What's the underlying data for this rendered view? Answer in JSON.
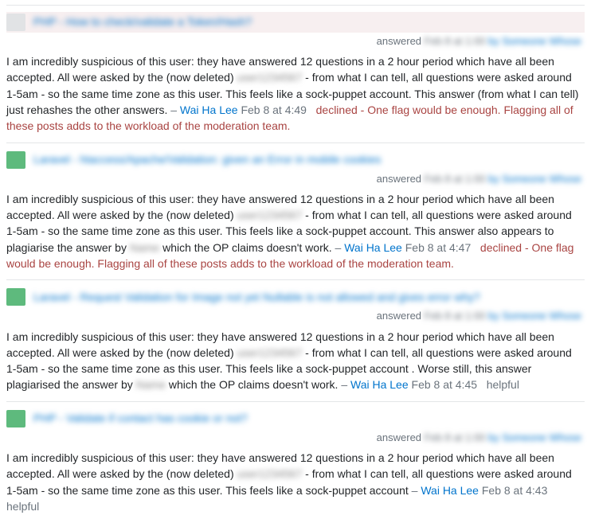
{
  "common": {
    "answered_label": "answered",
    "dash": "–",
    "author": "Wai Ha Lee",
    "redacted_user": "user1234567",
    "redacted_user2": "Name",
    "meta_date": "Feb 8 at 1:00",
    "meta_date2": "Feb 8 at 1:00",
    "meta_user": "by Someone Whose",
    "decline_msg": "declined - One flag would be enough. Flagging all of these posts adds to the workload of the moderation team.",
    "helpful_msg": "helpful"
  },
  "entries": [
    {
      "selected": true,
      "badge": "neutral",
      "title": "PHP - How to check/validate a Token/Hash?",
      "comment_pre": "I am incredibly suspicious of this user: they have answered 12 questions in a 2 hour period which have all been accepted. All were asked by the (now deleted) ",
      "comment_post": " - from what I can tell, all questions were asked around 1-5am - so the same time zone as this user. This feels like a sock-puppet account. This answer (from what I can tell) just rehashes the other answers.",
      "ts": "Feb 8 at 4:49",
      "result": "decline"
    },
    {
      "selected": false,
      "badge": "accepted",
      "title": "Laravel - htaccess/Apache/Validation: given an Error in mobile cookies",
      "comment_pre": "I am incredibly suspicious of this user: they have answered 12 questions in a 2 hour period which have all been accepted. All were asked by the (now deleted) ",
      "comment_mid": " - from what I can tell, all questions were asked around 1-5am - so the same time zone as this user. This feels like a sock-puppet account. This answer also appears to plagiarise the answer by ",
      "comment_post": " which the OP claims doesn't work.",
      "ts": "Feb 8 at 4:47",
      "result": "decline"
    },
    {
      "selected": false,
      "badge": "accepted",
      "title": "Laravel - Request Validation for Image not yet Nullable is not allowed and gives error why?",
      "comment_pre": "I am incredibly suspicious of this user: they have answered 12 questions in a 2 hour period which have all been accepted. All were asked by the (now deleted) ",
      "comment_mid": " - from what I can tell, all questions were asked around 1-5am - so the same time zone as this user. This feels like a sock-puppet account . Worse still, this answer plagiarised the answer by ",
      "comment_post": " which the OP claims doesn't work.",
      "ts": "Feb 8 at 4:45",
      "result": "helpful"
    },
    {
      "selected": false,
      "badge": "accepted",
      "title": "PHP - Validate if contact has cookie or not?",
      "comment_pre": "I am incredibly suspicious of this user: they have answered 12 questions in a 2 hour period which have all been accepted. All were asked by the (now deleted) ",
      "comment_post": " - from what I can tell, all questions were asked around 1-5am - so the same time zone as this user. This feels like a sock-puppet account",
      "ts": "Feb 8 at 4:43",
      "result": "helpful"
    }
  ]
}
